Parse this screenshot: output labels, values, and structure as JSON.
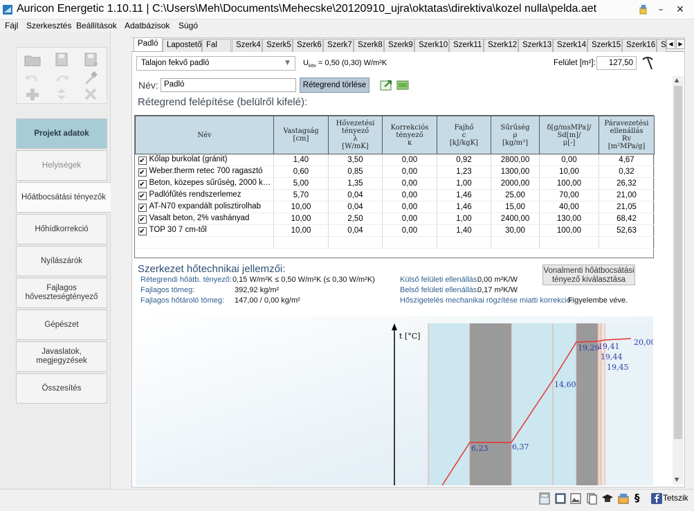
{
  "window": {
    "title": "Auricon Energetic 1.10.11 | C:\\Users\\Meh\\Documents\\Mehecske\\20120910_ujra\\oktatas\\direktiva\\kozel nulla\\pelda.aet",
    "minimize": "–",
    "close": "✕"
  },
  "menu": [
    "Fájl",
    "Szerkesztés",
    "Beállítások",
    "Adatbázisok",
    "Súgó"
  ],
  "nav": [
    {
      "label": "Projekt adatok",
      "state": "active"
    },
    {
      "label": "Helyiségek",
      "state": "disabled"
    },
    {
      "label": "Hőátbocsátási  tényezők",
      "state": "highlight"
    },
    {
      "label": "Hőhídkorrekció",
      "state": "normal"
    },
    {
      "label": "Nyílászárók",
      "state": "normal"
    },
    {
      "label": "Fajlagos hőveszteségtényező",
      "state": "normal"
    },
    {
      "label": "Gépészet",
      "state": "normal"
    },
    {
      "label": "Javaslatok, megjegyzések",
      "state": "normal"
    },
    {
      "label": "Összesítés",
      "state": "normal"
    }
  ],
  "tabs": [
    "Padló",
    "Lapostető",
    "Fal",
    "Szerk4",
    "Szerk5",
    "Szerk6",
    "Szerk7",
    "Szerk8",
    "Szerk9",
    "Szerk10",
    "Szerk11",
    "Szerk12",
    "Szerk13",
    "Szerk14",
    "Szerk15",
    "Szerk16",
    "S"
  ],
  "editor": {
    "floor_type": "Talajon fekvő padló",
    "ukov": "U",
    "ukov_sub": "köv",
    "ukov_value": " = 0,50 (0,30) W/m²K",
    "felulet_label": "Felület [m²]:",
    "felulet_value": "127,50",
    "name_label": "Név:",
    "name_value": "Padló",
    "clear_button": "Rétegrend törlése",
    "layers_title": "Rétegrend felépítése (belülről kifelé):"
  },
  "table": {
    "headers": [
      "Név",
      "Vastagság\n[cm]",
      "Hővezetési\ntényező\nλ\n[W/mK]",
      "Korrekciós\ntényező\nκ",
      "Fajhő\nc\n[kJ/kgK]",
      "Sűrűség\nρ\n[kg/m³]",
      "δ[g/msMPa]/\nSd[m]/\nμ[-]",
      "Páravezetési\nellenállás\nRv\n[m²MPa/g]"
    ],
    "rows": [
      [
        "Kőlap burkolat (gránit)",
        "1,40",
        "3,50",
        "0,00",
        "0,92",
        "2800,00",
        "0,00",
        "4,67"
      ],
      [
        "Weber.therm retec 700 ragasztó",
        "0,60",
        "0,85",
        "0,00",
        "1,23",
        "1300,00",
        "10,00",
        "0,32"
      ],
      [
        "Beton, közepes sűrűség, 2000 kg...",
        "5,00",
        "1,35",
        "0,00",
        "1,00",
        "2000,00",
        "100,00",
        "26,32"
      ],
      [
        "Padlófűtés rendszerlemez",
        "5,70",
        "0,04",
        "0,00",
        "1,46",
        "25,00",
        "70,00",
        "21,00"
      ],
      [
        "AT-N70 expandált polisztirolhab",
        "10,00",
        "0,04",
        "0,00",
        "1,46",
        "15,00",
        "40,00",
        "21,05"
      ],
      [
        "Vasalt beton, 2% vashányad",
        "10,00",
        "2,50",
        "0,00",
        "1,00",
        "2400,00",
        "130,00",
        "68,42"
      ],
      [
        "TOP 30 7 cm-től",
        "10,00",
        "0,04",
        "0,00",
        "1,40",
        "30,00",
        "100,00",
        "52,63"
      ]
    ]
  },
  "props": {
    "title": "Szerkezet hőtechnikai jellemzői:",
    "u_label": "Rétegrendi hőátb. tényező:",
    "u_value": "0,15 W/m²K  ≤  0,50 W/m²K  (≤  0,30 W/m²K)",
    "mass_label": "Fajlagos tömeg:",
    "mass_value": "392,92 kg/m²",
    "heat_label": "Fajlagos hőtároló tömeg:",
    "heat_value": "147,00 / 0,00 kg/m²",
    "ext_label": "Külső felületi ellenállás:",
    "ext_value": "0,00 m²K/W",
    "int_label": "Belső felületi ellenállás:",
    "int_value": "0,17 m²K/W",
    "mech_label": "Hőszigetelés mechanikai rögzítése miatti korrekció:",
    "mech_value": "Figyelembe véve.",
    "vonal_button": "Vonalmenti hőátbocsátási tényező kiválasztása"
  },
  "chart_data": {
    "type": "line",
    "ylabel": "t [°C]",
    "temperature_labels": [
      "6,23",
      "6,37",
      "14,60",
      "19,29",
      "19,41",
      "19,44",
      "19,45",
      "20,00"
    ],
    "colors": {
      "insulation": "#cce7ef",
      "concrete": "#9a9a9a",
      "line": "#e53333",
      "labels": "#2b3fa8"
    }
  },
  "statusbar": {
    "help_label": "Tetszik"
  }
}
